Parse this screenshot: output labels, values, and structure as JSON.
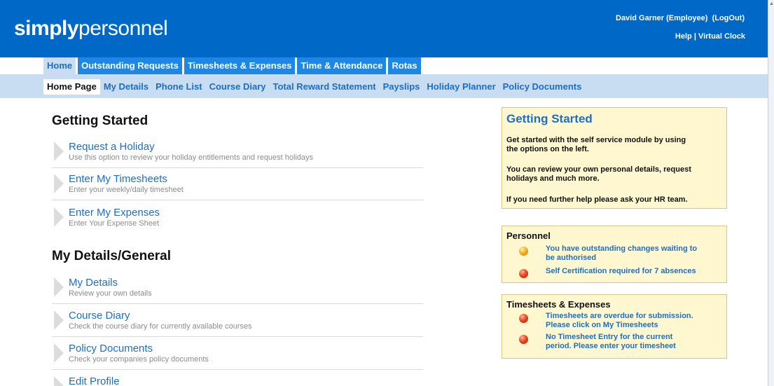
{
  "header": {
    "logo_bold": "simply",
    "logo_regular": "personnel",
    "user": "David Garner (Employee)",
    "logout": "(LogOut)",
    "help": "Help",
    "separator": "|",
    "virtual_clock": "Virtual Clock"
  },
  "main_tabs": [
    {
      "label": "Home"
    },
    {
      "label": "Outstanding Requests"
    },
    {
      "label": "Timesheets & Expenses"
    },
    {
      "label": "Time & Attendance"
    },
    {
      "label": "Rotas"
    }
  ],
  "sub_nav": [
    {
      "label": "Home Page"
    },
    {
      "label": "My Details"
    },
    {
      "label": "Phone List"
    },
    {
      "label": "Course Diary"
    },
    {
      "label": "Total Reward Statement"
    },
    {
      "label": "Payslips"
    },
    {
      "label": "Holiday Planner"
    },
    {
      "label": "Policy Documents"
    }
  ],
  "sections": [
    {
      "title": "Getting Started",
      "items": [
        {
          "title": "Request a Holiday",
          "desc": "Use this option to review your holiday entitlements and request holidays"
        },
        {
          "title": "Enter My Timesheets",
          "desc": "Enter your weekly/daily timesheet"
        },
        {
          "title": "Enter My Expenses",
          "desc": "Enter Your Expense Sheet"
        }
      ]
    },
    {
      "title": "My Details/General",
      "items": [
        {
          "title": "My Details",
          "desc": "Review your own details"
        },
        {
          "title": "Course Diary",
          "desc": "Check the course diary for currently available courses"
        },
        {
          "title": "Policy Documents",
          "desc": "Check your companies policy documents"
        },
        {
          "title": "Edit Profile",
          "desc": ""
        }
      ]
    }
  ],
  "info_box": {
    "title": "Getting Started",
    "para1_line1": "Get started with the self service module by using",
    "para1_line2": "the options on the left.",
    "para2_line1": "You can review your own personal details, request",
    "para2_line2": "holidays and much more.",
    "para3": "If you need further help please ask your HR team."
  },
  "personnel_box": {
    "title": "Personnel",
    "alerts": [
      {
        "line1": "You have outstanding changes waiting to",
        "line2": "be authorised",
        "status": "orange"
      },
      {
        "line1": "Self Certification required for 7 absences",
        "line2": "",
        "status": "red"
      }
    ]
  },
  "timesheets_box": {
    "title": "Timesheets & Expenses",
    "alerts": [
      {
        "line1": "Timesheets are overdue for submission.",
        "line2": "Please click on My Timesheets",
        "status": "red"
      },
      {
        "line1": "No Timesheet Entry for the current",
        "line2": "period. Please enter your timesheet",
        "status": "red"
      }
    ]
  },
  "colors": {
    "header_blue": "#0069c8",
    "tab_blue": "#1e87e5",
    "subnav_bg": "#c8dcf2",
    "link_blue": "#1f6fc0",
    "box_bg": "#fff7cf"
  }
}
